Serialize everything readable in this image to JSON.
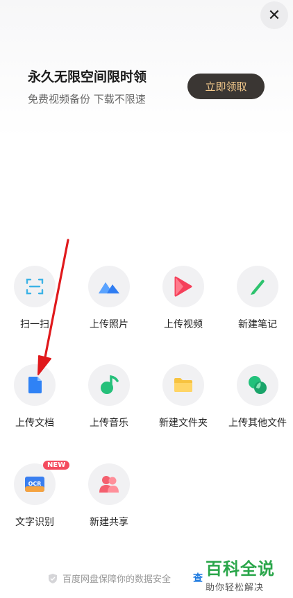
{
  "close_glyph": "✕",
  "promo": {
    "title": "永久无限空间限时领",
    "subtitle": "免费视频备份 下载不限速",
    "button": "立即领取"
  },
  "grid": [
    {
      "label": "扫一扫",
      "icon": "scan-icon"
    },
    {
      "label": "上传照片",
      "icon": "mountain-photo-icon"
    },
    {
      "label": "上传视频",
      "icon": "play-video-icon"
    },
    {
      "label": "新建笔记",
      "icon": "pen-icon"
    },
    {
      "label": "上传文档",
      "icon": "document-icon"
    },
    {
      "label": "上传音乐",
      "icon": "music-note-icon"
    },
    {
      "label": "新建文件夹",
      "icon": "folder-icon"
    },
    {
      "label": "上传其他文件",
      "icon": "other-files-icon"
    },
    {
      "label": "文字识别",
      "icon": "ocr-icon",
      "badge": "NEW",
      "icon_text": "OCR"
    },
    {
      "label": "新建共享",
      "icon": "share-users-icon"
    }
  ],
  "footer": {
    "safe_text": "百度网盘保障你的数据安全",
    "link_text": "查"
  },
  "watermark": {
    "main": "百科全说",
    "sub": "助你轻松解决"
  },
  "colors": {
    "scan": "#3db3e6",
    "photo": "#2f7df2",
    "video": "#f5405a",
    "note": "#2ec36e",
    "document": "#2f82f5",
    "music": "#25c07a",
    "folder": "#f7c340",
    "other": "#22c17b",
    "ocr": "#3a7ff0",
    "share": "#f45f6e"
  }
}
